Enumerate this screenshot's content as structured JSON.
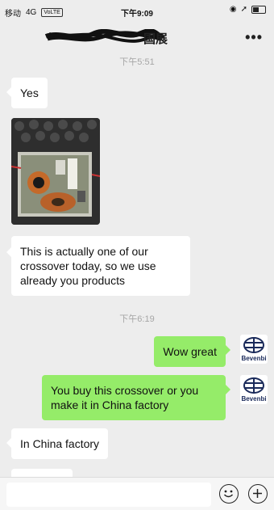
{
  "status_bar": {
    "carrier": "移动",
    "network": "4G",
    "volte": "VoLTE",
    "time": "下午9:09"
  },
  "nav": {
    "title": "国展",
    "more_icon": "more-dots-icon"
  },
  "messages": [
    {
      "type": "timestamp",
      "text": "下午5:51"
    },
    {
      "type": "text",
      "side": "left",
      "text": "Yes"
    },
    {
      "type": "image",
      "side": "left"
    },
    {
      "type": "text",
      "side": "left",
      "text": "This is actually one of our crossover today, so we use already you products"
    },
    {
      "type": "timestamp",
      "text": "下午6:19"
    },
    {
      "type": "text",
      "side": "right",
      "text": "Wow great",
      "avatar_label": "Bevenbi"
    },
    {
      "type": "text",
      "side": "right",
      "text": "You buy this crossover or you make it in China factory",
      "avatar_label": "Bevenbi"
    },
    {
      "type": "text",
      "side": "left",
      "text": "In China factory"
    }
  ],
  "input_bar": {
    "placeholder": "",
    "emoji_icon": "emoji-icon",
    "plus_icon": "plus-icon"
  },
  "colors": {
    "background": "#ededed",
    "sent_bubble": "#95ec69",
    "received_bubble": "#ffffff"
  }
}
